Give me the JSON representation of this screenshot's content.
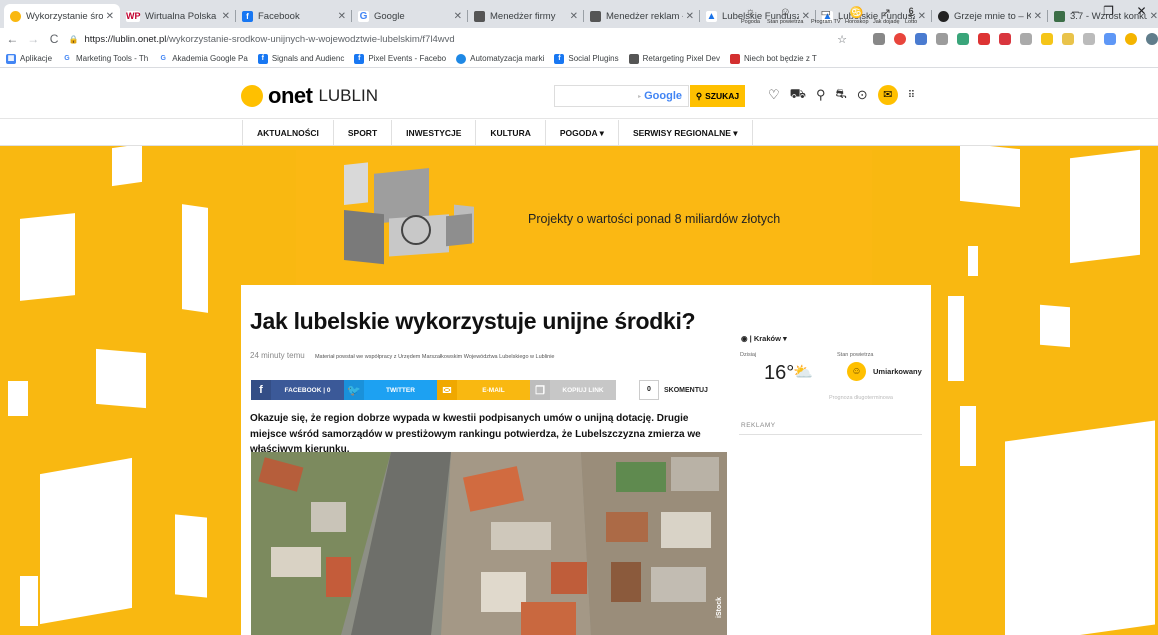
{
  "browser": {
    "tabs": [
      {
        "title": "Wykorzystanie środ",
        "color": "#f9b811",
        "icon": "onet-favicon"
      },
      {
        "title": "Wirtualna Polska - ",
        "color": "#c2002f",
        "icon": "wp-favicon"
      },
      {
        "title": "Facebook",
        "color": "#1877f2",
        "icon": "facebook-favicon"
      },
      {
        "title": "Google",
        "color": "#4285f4",
        "icon": "google-favicon"
      },
      {
        "title": "Menedżer firmy",
        "color": "#555555",
        "icon": "business-manager-favicon"
      },
      {
        "title": "Menedżer reklam -",
        "color": "#555555",
        "icon": "ads-manager-favicon"
      },
      {
        "title": "Lubelskie Fundusz",
        "color": "#1a73e8",
        "icon": "google-ads-favicon"
      },
      {
        "title": "Lubelskie Fundusz",
        "color": "#1a73e8",
        "icon": "google-ads-favicon"
      },
      {
        "title": "Grzeje mnie to – K",
        "color": "#222222",
        "icon": "wordpress-favicon"
      },
      {
        "title": "3.7 - Wzrost konku",
        "color": "#3c6e47",
        "icon": "slides-favicon"
      }
    ],
    "new_tab": "+",
    "window_controls": [
      "–",
      "❐",
      "✕"
    ],
    "url_host": "https://lublin.onet.pl",
    "url_path": "/wykorzystanie-srodkow-unijnych-w-wojewodztwie-lubelskim/f7l4wvd",
    "bookmarks": [
      {
        "label": "Aplikacje",
        "color": "#4285f4"
      },
      {
        "label": "Marketing Tools - Th",
        "color": "#4285f4"
      },
      {
        "label": "Akademia Google Pa",
        "color": "#4285f4"
      },
      {
        "label": "Signals and Audienc",
        "color": "#1877f2"
      },
      {
        "label": "Pixel Events - Facebo",
        "color": "#1877f2"
      },
      {
        "label": "Automatyzacja marki",
        "color": "#1e88e5"
      },
      {
        "label": "Social Plugins",
        "color": "#1877f2"
      },
      {
        "label": "Retargeting Pixel Dev",
        "color": "#555555"
      },
      {
        "label": "Niech bot będzie z T",
        "color": "#d32f2f"
      }
    ]
  },
  "site": {
    "logo_brand": "onet",
    "logo_city": "LUBLIN",
    "search_placeholder": "Google",
    "search_button": "SZUKAJ",
    "nav": [
      "AKTUALNOŚCI",
      "SPORT",
      "INWESTYCJE",
      "KULTURA",
      "POGODA ▾",
      "SERWISY REGIONALNE ▾"
    ],
    "accent": "#ffc000",
    "background": "#f9b811"
  },
  "banner": {
    "text": "Projekty o wartości ponad 8 miliardów złotych"
  },
  "article": {
    "title": "Jak lubelskie wykorzystuje unijne środki?",
    "time": "24 minuty temu",
    "sponsor_note": "Materiał powstał we współpracy z Urzędem Marszałkowskim Województwa Lubelskiego w Lublinie",
    "share": {
      "facebook": "FACEBOOK | 0",
      "twitter": "TWITTER",
      "email": "E-MAIL",
      "copy": "KOPIUJ LINK",
      "comment_count": "0",
      "comments": "SKOMENTUJ"
    },
    "lead": "Okazuje się, że region dobrze wypada w kwestii podpisanych umów o unijną dotację. Drugie miejsce wśród samorządów w prestiżowym rankingu potwierdza, że Lubelszczyzna zmierza we właściwym kierunku.",
    "photo_credit": "iStock"
  },
  "sidebar": {
    "services": [
      "Pogoda",
      "Stan powietrza",
      "Program TV",
      "Horoskop",
      "Jak dojadę",
      "Lotto"
    ],
    "location": "Kraków ▾",
    "today_label": "Dzisiaj",
    "temperature": "16°",
    "air_label": "Stan powietrza",
    "air_quality": "Umiarkowany",
    "forecast_link": "Prognoza długoterminowa",
    "ads_label": "REKLAMY"
  }
}
